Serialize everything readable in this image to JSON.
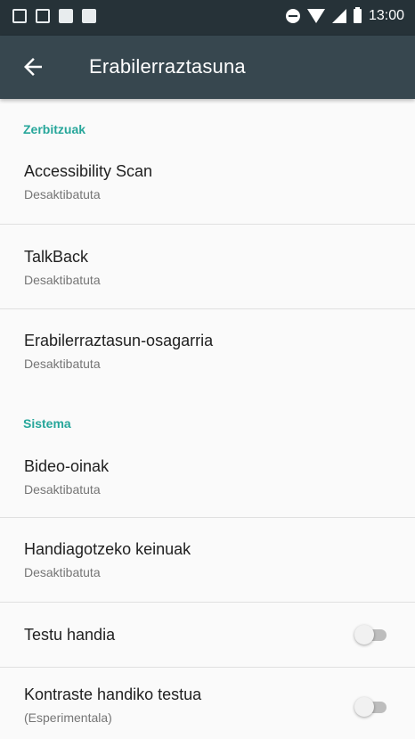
{
  "status_bar": {
    "time": "13:00",
    "left_icons": [
      "gallery-icon",
      "gmail-icon",
      "bag-icon",
      "bag-icon"
    ],
    "right_icons": [
      "do-not-disturb-icon",
      "wifi-icon",
      "signal-icon",
      "battery-icon"
    ]
  },
  "app_bar": {
    "title": "Erabilerraztasuna",
    "back_icon": "arrow-left-icon"
  },
  "sections": [
    {
      "header": "Zerbitzuak",
      "items": [
        {
          "title": "Accessibility Scan",
          "subtitle": "Desaktibatuta"
        },
        {
          "title": "TalkBack",
          "subtitle": "Desaktibatuta"
        },
        {
          "title": "Erabilerraztasun-osagarria",
          "subtitle": "Desaktibatuta"
        }
      ]
    },
    {
      "header": "Sistema",
      "items": [
        {
          "title": "Bideo-oinak",
          "subtitle": "Desaktibatuta"
        },
        {
          "title": "Handiagotzeko keinuak",
          "subtitle": "Desaktibatuta"
        },
        {
          "title": "Testu handia",
          "toggle_on": false
        },
        {
          "title": "Kontraste handiko testua",
          "subtitle": "(Esperimentala)",
          "toggle_on": false
        }
      ]
    }
  ],
  "colors": {
    "status_bar": "#263238",
    "app_bar": "#37474f",
    "accent": "#26a69a",
    "background": "#fafafa"
  }
}
